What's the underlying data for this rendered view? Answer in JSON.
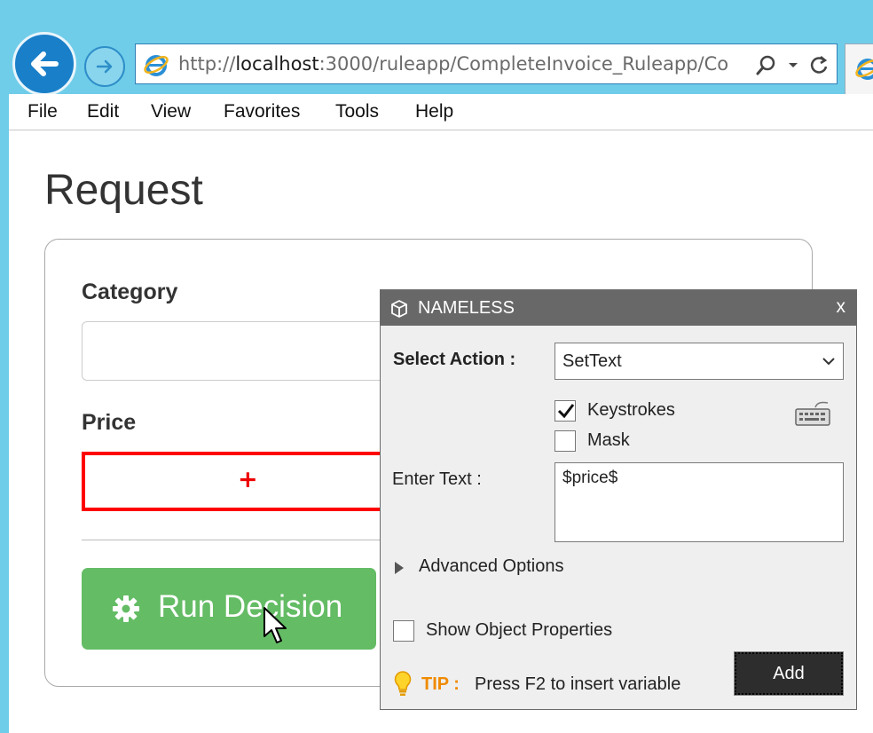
{
  "browser": {
    "url_prefix": "http://",
    "url_host": "localhost",
    "url_rest": ":3000/ruleapp/CompleteInvoice_Ruleapp/Co",
    "icons": [
      "back-arrow-icon",
      "forward-arrow-icon",
      "ie-logo-icon",
      "search-icon",
      "dropdown-icon",
      "refresh-icon"
    ]
  },
  "menu": {
    "file": "File",
    "edit": "Edit",
    "view": "View",
    "favorites": "Favorites",
    "tools": "Tools",
    "help": "Help"
  },
  "page": {
    "title": "Request",
    "category_label": "Category",
    "category_value": "",
    "price_label": "Price",
    "price_marker": "+",
    "run_button_label": "Run Decision"
  },
  "dialog": {
    "title": "NAMELESS",
    "close": "x",
    "select_action_label": "Select Action :",
    "select_action_value": "SetText",
    "keystrokes_label": "Keystrokes",
    "keystrokes_checked": true,
    "mask_label": "Mask",
    "mask_checked": false,
    "enter_text_label": "Enter Text :",
    "enter_text_value": "$price$",
    "advanced_options_label": "Advanced Options",
    "show_props_label": "Show Object Properties",
    "show_props_checked": false,
    "tip_label": "TIP :",
    "tip_text": "Press F2 to insert variable",
    "add_button_label": "Add"
  },
  "colors": {
    "chrome_bg": "#6fcde9",
    "run_button": "#64bc65",
    "price_border": "#ff0000",
    "dialog_header": "#686868",
    "tip_color": "#f08a00"
  }
}
